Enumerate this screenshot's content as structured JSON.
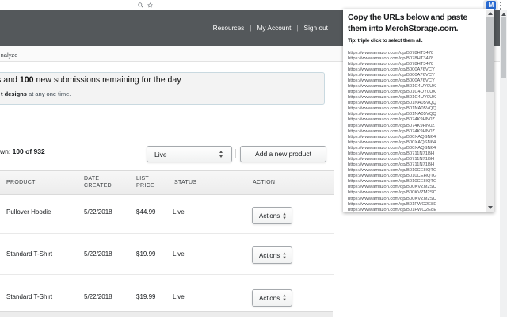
{
  "browser": {
    "extension_icon_label": "M",
    "accent_blue": "#2a6bd2"
  },
  "page": {
    "header": {
      "links": [
        {
          "label": "Resources"
        },
        {
          "label": "My Account"
        },
        {
          "label": "Sign out"
        }
      ],
      "separator": "|",
      "bg_color": "#54585b"
    },
    "nav": {
      "visible_tab_fragment": "nalyze"
    },
    "notice": {
      "line1_prefix": "s and ",
      "line1_bold": "100",
      "line1_rest": " new submissions remaining for the day",
      "line2_bold": "t designs",
      "line2_rest": " at any one time."
    },
    "summary": {
      "prefix": "wn: ",
      "count": "100 of 932"
    },
    "filter_select": {
      "value": "Live"
    },
    "add_button_label": "Add a new product",
    "table": {
      "headers": {
        "product": "PRODUCT",
        "date": "DATE CREATED",
        "price": "LIST PRICE",
        "status": "STATUS",
        "action": "ACTION"
      },
      "rows": [
        {
          "product": "Pullover Hoodie",
          "date": "5/22/2018",
          "price": "$44.99",
          "status": "Live",
          "action": "Actions"
        },
        {
          "product": "Standard T-Shirt",
          "date": "5/22/2018",
          "price": "$19.99",
          "status": "Live",
          "action": "Actions"
        },
        {
          "product": "Standard T-Shirt",
          "date": "5/22/2018",
          "price": "$19.99",
          "status": "Live",
          "action": "Actions"
        }
      ]
    }
  },
  "popup": {
    "title_line1": "Copy the URLs below and paste",
    "title_line2": "them into MerchStorage.com.",
    "tip": "Tip: triple click to select them all.",
    "urls": [
      "https://www.amazon.com/dp/B078HT3478",
      "https://www.amazon.com/dp/B078HT3478",
      "https://www.amazon.com/dp/B078HT3478",
      "https://www.amazon.com/dp/B000A76VCY",
      "https://www.amazon.com/dp/B000A76VCY",
      "https://www.amazon.com/dp/B000A76VCY",
      "https://www.amazon.com/dp/B01C4UY0UK",
      "https://www.amazon.com/dp/B01C4UY0UK",
      "https://www.amazon.com/dp/B01C4UY0UK",
      "https://www.amazon.com/dp/B01NA05VQQ",
      "https://www.amazon.com/dp/B01NA05VQQ",
      "https://www.amazon.com/dp/B01NA05VQQ",
      "https://www.amazon.com/dp/B074K9HN0Z",
      "https://www.amazon.com/dp/B074K9HN0Z",
      "https://www.amazon.com/dp/B074K9HN0Z",
      "https://www.amazon.com/dp/B00XAQSN64",
      "https://www.amazon.com/dp/B00XAQSN64",
      "https://www.amazon.com/dp/B00XAQSN64",
      "https://www.amazon.com/dp/B0711N71BH",
      "https://www.amazon.com/dp/B0711N71BH",
      "https://www.amazon.com/dp/B0711N71BH",
      "https://www.amazon.com/dp/B010CEHQTG",
      "https://www.amazon.com/dp/B010CEHQTG",
      "https://www.amazon.com/dp/B010CEHQTG",
      "https://www.amazon.com/dp/B00KVZM2SC",
      "https://www.amazon.com/dp/B00KVZM2SC",
      "https://www.amazon.com/dp/B00KVZM2SC",
      "https://www.amazon.com/dp/B01FWO2E8E",
      "https://www.amazon.com/dp/B01FWO2E8E",
      "https://www.amazon.com/dp/B01FWO2E8E"
    ]
  }
}
